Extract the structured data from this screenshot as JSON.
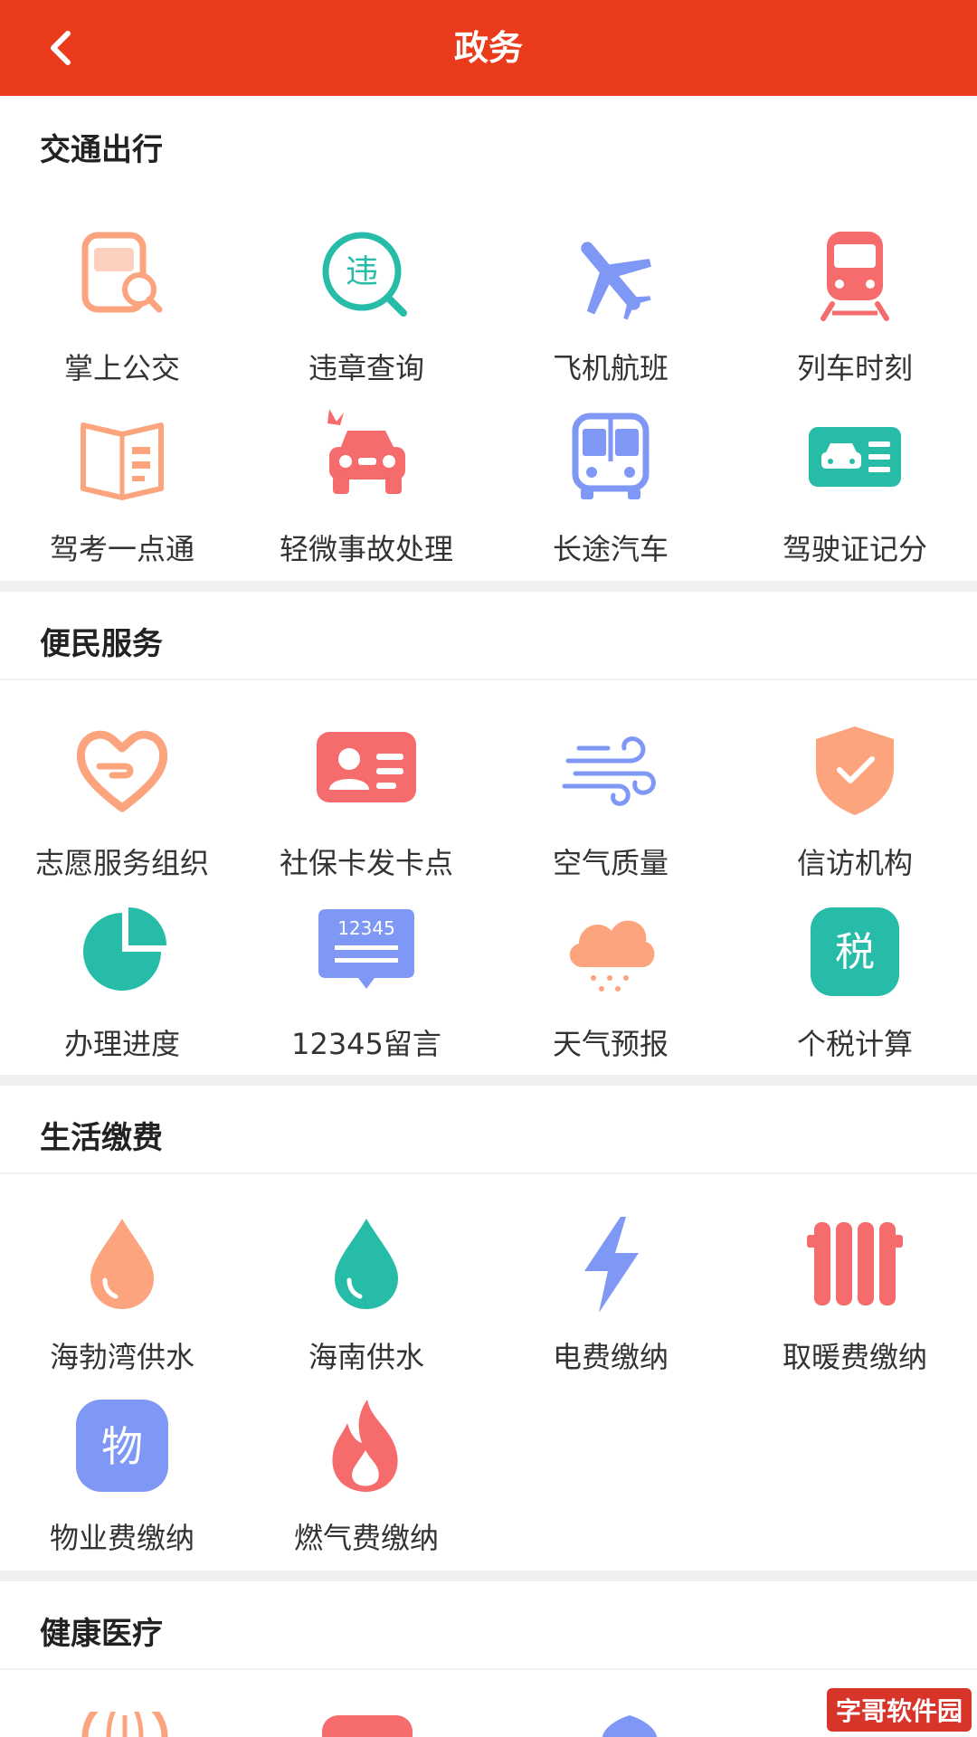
{
  "header": {
    "title": "政务"
  },
  "sections": [
    {
      "title": "交通出行",
      "items": [
        {
          "label": "掌上公交",
          "icon": "bus-search-icon"
        },
        {
          "label": "违章查询",
          "icon": "violation-search-icon",
          "glyph": "违"
        },
        {
          "label": "飞机航班",
          "icon": "airplane-icon"
        },
        {
          "label": "列车时刻",
          "icon": "train-icon"
        },
        {
          "label": "驾考一点通",
          "icon": "open-book-icon"
        },
        {
          "label": "轻微事故处理",
          "icon": "car-accident-icon"
        },
        {
          "label": "长途汽车",
          "icon": "coach-bus-icon"
        },
        {
          "label": "驾驶证记分",
          "icon": "driver-license-icon"
        }
      ]
    },
    {
      "title": "便民服务",
      "items": [
        {
          "label": "志愿服务组织",
          "icon": "heart-hand-icon"
        },
        {
          "label": "社保卡发卡点",
          "icon": "id-card-icon"
        },
        {
          "label": "空气质量",
          "icon": "wind-icon"
        },
        {
          "label": "信访机构",
          "icon": "shield-check-icon"
        },
        {
          "label": "办理进度",
          "icon": "pie-chart-icon"
        },
        {
          "label": "12345留言",
          "icon": "message-bubble-icon",
          "glyph": "12345"
        },
        {
          "label": "天气预报",
          "icon": "cloud-rain-icon"
        },
        {
          "label": "个税计算",
          "icon": "tax-icon",
          "glyph": "税"
        }
      ]
    },
    {
      "title": "生活缴费",
      "items": [
        {
          "label": "海勃湾供水",
          "icon": "water-drop-orange-icon"
        },
        {
          "label": "海南供水",
          "icon": "water-drop-teal-icon"
        },
        {
          "label": "电费缴纳",
          "icon": "lightning-icon"
        },
        {
          "label": "取暖费缴纳",
          "icon": "radiator-icon"
        },
        {
          "label": "物业费缴纳",
          "icon": "property-icon",
          "glyph": "物"
        },
        {
          "label": "燃气费缴纳",
          "icon": "flame-icon"
        }
      ]
    },
    {
      "title": "健康医疗",
      "items": []
    }
  ],
  "watermark": "字哥软件园",
  "colors": {
    "header": "#ea3b1d",
    "orange": "#fba47d",
    "teal": "#26bca8",
    "blue": "#7f98f5",
    "red": "#f66b6b"
  }
}
